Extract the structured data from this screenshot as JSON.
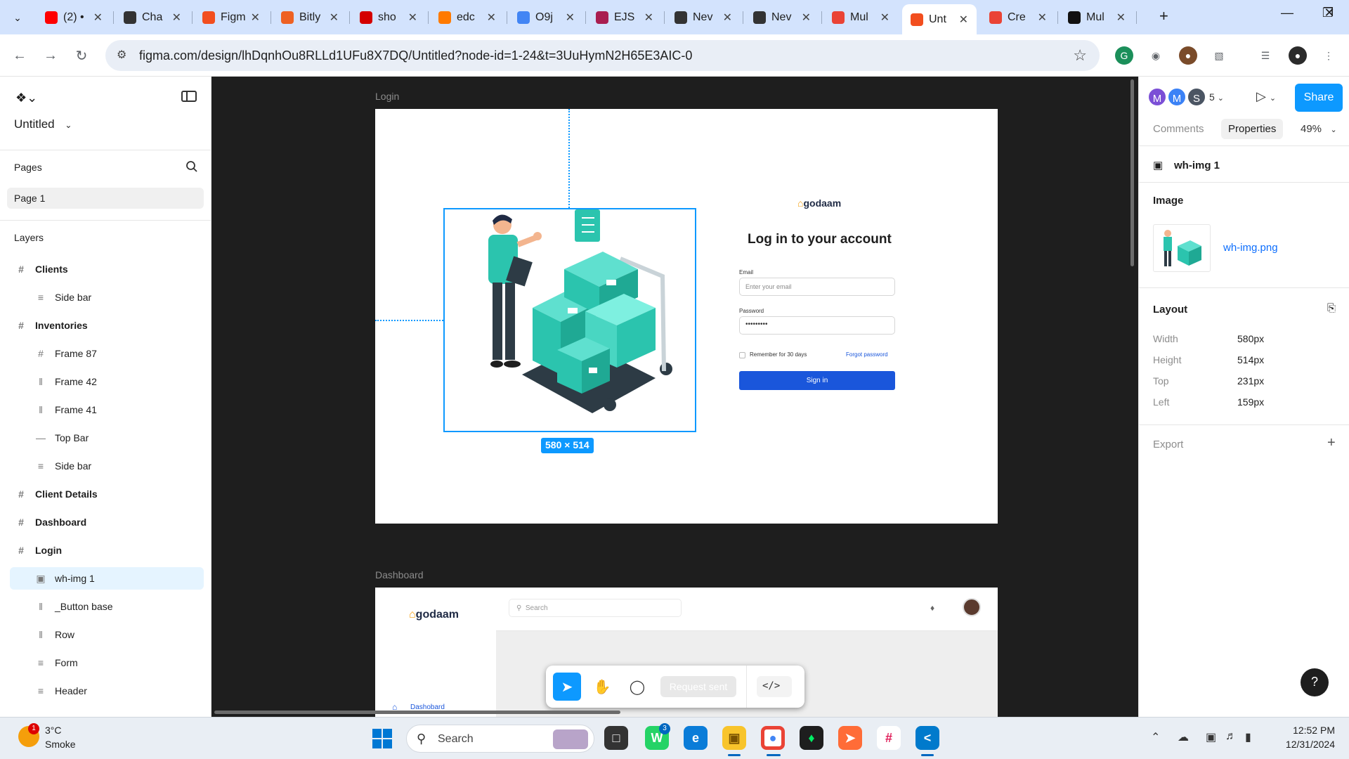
{
  "browser": {
    "tabs": [
      {
        "label": "(2) •",
        "icon": "youtube-icon",
        "color": "#ff0000"
      },
      {
        "label": "Cha",
        "icon": "chatgpt-icon",
        "color": "#333333"
      },
      {
        "label": "Figm",
        "icon": "figma-icon",
        "color": "#f24e1e"
      },
      {
        "label": "Bitly",
        "icon": "bitly-icon",
        "color": "#ee6123"
      },
      {
        "label": "sho",
        "icon": "bookmark-icon",
        "color": "#d40000"
      },
      {
        "label": "edc",
        "icon": "edge-icon",
        "color": "#ff7a00"
      },
      {
        "label": "O9j",
        "icon": "google-icon",
        "color": "#4285f4"
      },
      {
        "label": "EJS",
        "icon": "ejs-icon",
        "color": "#a91e50"
      },
      {
        "label": "Nev",
        "icon": "chatgpt-icon",
        "color": "#333333"
      },
      {
        "label": "Nev",
        "icon": "chatgpt-icon",
        "color": "#333333"
      },
      {
        "label": "Mul",
        "icon": "gmail-icon",
        "color": "#ea4335"
      },
      {
        "label": "Unt",
        "icon": "figma-icon",
        "color": "#f24e1e",
        "active": true
      },
      {
        "label": "Cre",
        "icon": "canva-icon",
        "color": "#ea4335"
      },
      {
        "label": "Mul",
        "icon": "github-icon",
        "color": "#111111"
      }
    ],
    "url": "figma.com/design/lhDqnhOu8RLLd1UFu8X7DQ/Untitled?node-id=1-24&t=3UuHymN2H65E3AIC-0"
  },
  "figma": {
    "file_title": "Untitled",
    "pages_label": "Pages",
    "page_name": "Page 1",
    "layers_label": "Layers",
    "layers": [
      {
        "name": "Clients",
        "level": "top",
        "icon": "#"
      },
      {
        "name": "Side bar",
        "level": "child",
        "icon": "≡"
      },
      {
        "name": "Inventories",
        "level": "top",
        "icon": "#"
      },
      {
        "name": "Frame 87",
        "level": "child",
        "icon": "#"
      },
      {
        "name": "Frame 42",
        "level": "child",
        "icon": "‖"
      },
      {
        "name": "Frame 41",
        "level": "child",
        "icon": "‖"
      },
      {
        "name": "Top Bar",
        "level": "child",
        "icon": "—"
      },
      {
        "name": "Side bar",
        "level": "child",
        "icon": "≡"
      },
      {
        "name": "Client Details",
        "level": "top",
        "icon": "#"
      },
      {
        "name": "Dashboard",
        "level": "top",
        "icon": "#"
      },
      {
        "name": "Login",
        "level": "top",
        "icon": "#"
      },
      {
        "name": "wh-img 1",
        "level": "child",
        "icon": "▣",
        "selected": true
      },
      {
        "name": "_Button base",
        "level": "child",
        "icon": "‖"
      },
      {
        "name": "Row",
        "level": "child",
        "icon": "‖"
      },
      {
        "name": "Form",
        "level": "child",
        "icon": "≡"
      },
      {
        "name": "Header",
        "level": "child",
        "icon": "≡"
      }
    ],
    "canvas": {
      "login_frame_label": "Login",
      "dashboard_frame_label": "Dashboard",
      "selection_size": "580 × 514",
      "login": {
        "logo": "godaam",
        "title": "Log in to your account",
        "email_label": "Email",
        "email_placeholder": "Enter your email",
        "password_label": "Password",
        "password_value": "•••••••••",
        "remember": "Remember for 30 days",
        "forgot": "Forgot password",
        "signin": "Sign in"
      },
      "dashboard": {
        "logo": "godaam",
        "search_placeholder": "Search",
        "nav_item": "Dashobard"
      },
      "toolbar": {
        "request_label": "Request sent"
      }
    },
    "right": {
      "avatars": [
        {
          "letter": "M",
          "color": "#7b4fd6"
        },
        {
          "letter": "M",
          "color": "#3b82f6"
        },
        {
          "letter": "S",
          "color": "#4b5563"
        }
      ],
      "avatar_count": "5",
      "share": "Share",
      "tab_comments": "Comments",
      "tab_properties": "Properties",
      "zoom": "49%",
      "selected_name": "wh-img 1",
      "image_section": "Image",
      "image_file": "wh-img.png",
      "layout_section": "Layout",
      "props": [
        {
          "label": "Width",
          "value": "580px"
        },
        {
          "label": "Height",
          "value": "514px"
        },
        {
          "label": "Top",
          "value": "231px"
        },
        {
          "label": "Left",
          "value": "159px"
        }
      ],
      "export_section": "Export",
      "help": "?"
    }
  },
  "taskbar": {
    "temp": "3°C",
    "condition": "Smoke",
    "weather_badge": "1",
    "search_label": "Search",
    "whatsapp_badge": "3",
    "time": "12:52 PM",
    "date": "12/31/2024"
  }
}
